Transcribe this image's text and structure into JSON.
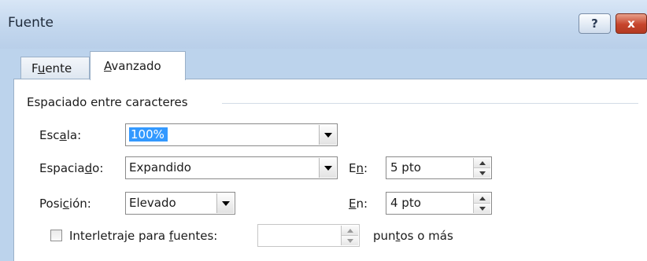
{
  "window": {
    "title": "Fuente",
    "help_label": "?",
    "close_label": "x"
  },
  "tabs": [
    {
      "pre": "F",
      "ul": "u",
      "post": "ente",
      "active": false
    },
    {
      "pre": "",
      "ul": "A",
      "post": "vanzado",
      "active": true
    }
  ],
  "section": {
    "title": "Espaciado entre caracteres"
  },
  "escala": {
    "label_pre": "Esc",
    "label_ul": "a",
    "label_post": "la:",
    "value": "100%"
  },
  "espaciado": {
    "label_pre": "Espacia",
    "label_ul": "d",
    "label_post": "o:",
    "value": "Expandido",
    "en_pre": "E",
    "en_ul": "n",
    "en_post": ":",
    "en_value": "5 pto"
  },
  "posicion": {
    "label_pre": "Posi",
    "label_ul": "c",
    "label_post": "ión:",
    "value": "Elevado",
    "en_pre": "",
    "en_ul": "E",
    "en_post": "n:",
    "en_value": "4 pto"
  },
  "interletraje": {
    "checked": false,
    "label_pre": "Interletraje para ",
    "label_ul": "f",
    "label_post": "uentes:",
    "value": "",
    "suffix_pre": "pun",
    "suffix_ul": "t",
    "suffix_post": "os o más"
  }
}
